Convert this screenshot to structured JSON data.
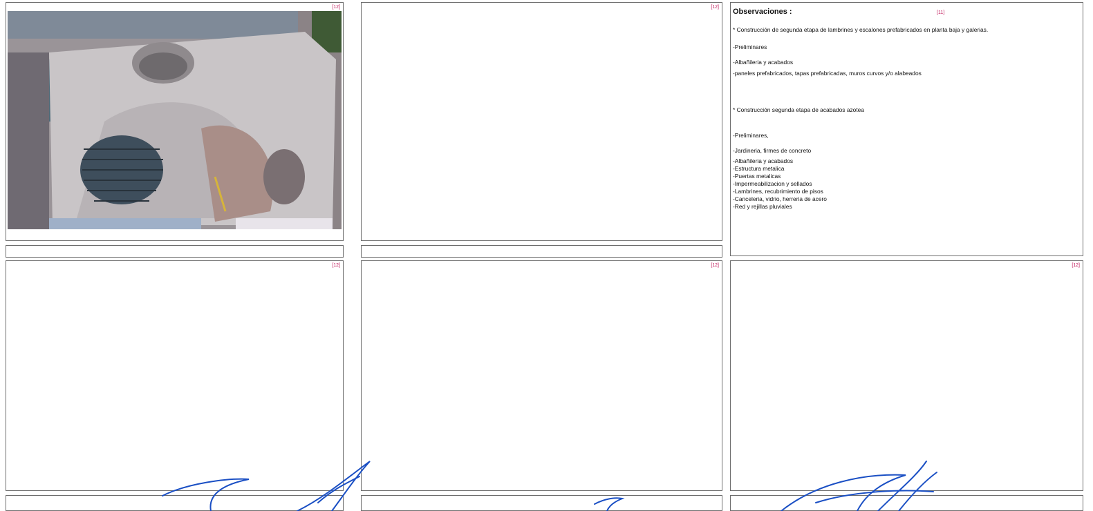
{
  "boxes": {
    "box1": {
      "tag": "[12]"
    },
    "box2": {
      "tag": "[12]"
    },
    "box4": {
      "tag": "[12]"
    },
    "box5": {
      "tag": "[12]"
    },
    "box6": {
      "tag": "[12]"
    }
  },
  "observations": {
    "title": "Observaciones :",
    "tag": "[11]",
    "lines": [
      "* Construcción de segunda etapa de lambrines y escalones prefabricados en planta baja y galerias.",
      "-Preliminares",
      "-Albañileria y acabados",
      "-paneles prefabricados, tapas prefabricadas, muros curvos y/o alabeados",
      "* Construcción segunda etapa de acabados azotea",
      "-Preliminares,",
      "-Jardineria, firmes de concreto",
      "-Albañileria y acabados",
      "-Estructura metalica",
      "-Puertas metalicas",
      "-Impermeabilizacion y sellados",
      "-Lambrines, recubrimiento de pisos",
      "-Canceleria, vidrio, herreria de acero",
      "-Red y rejillas pluviales"
    ]
  },
  "colors": {
    "tag": "#c0185a",
    "signature_ink": "#1a4fc4",
    "border": "#6d6d6d"
  },
  "images": {
    "aerial_photo": "aerial-construction-photo"
  }
}
